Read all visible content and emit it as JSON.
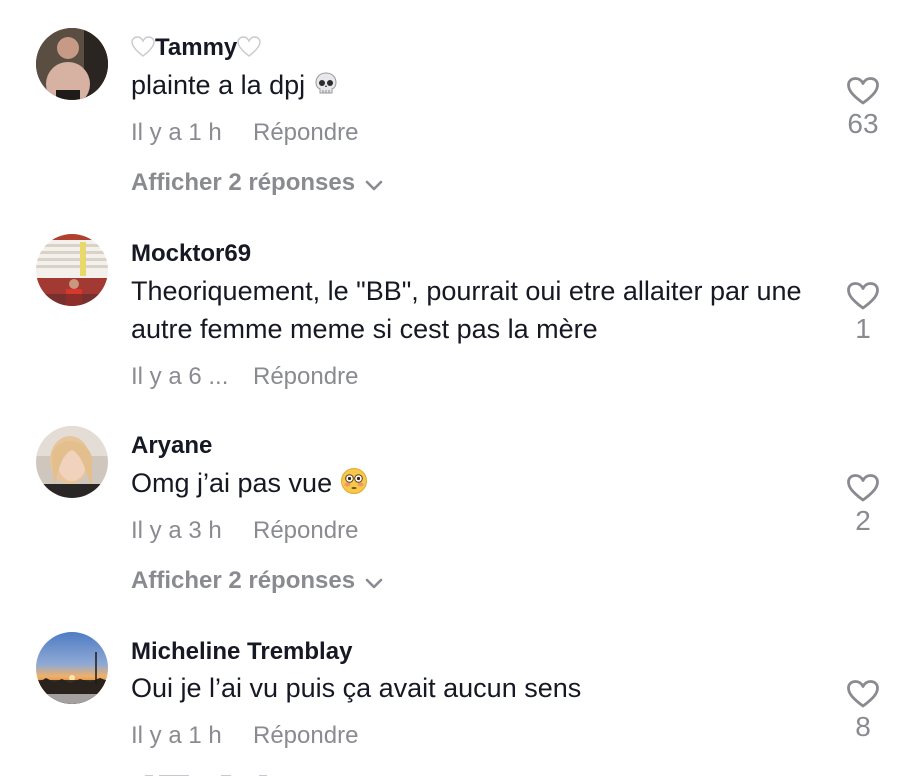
{
  "comments": [
    {
      "username": "Tammy",
      "text": "plainte a la dpj",
      "time": "Il y a 1 h",
      "reply_label": "Répondre",
      "likes": "63",
      "replies_label": "Afficher 2 réponses",
      "emoji_icon": "skull-emoji"
    },
    {
      "username": "Mocktor69",
      "text": "Theoriquement, le \"BB\", pourrait oui etre allaiter par une autre femme meme si cest pas la mère",
      "time": "Il y a 6 ...",
      "reply_label": "Répondre",
      "likes": "1"
    },
    {
      "username": "Aryane",
      "text": "Omg j’ai pas vue",
      "time": "Il y a 3 h",
      "reply_label": "Répondre",
      "likes": "2",
      "replies_label": "Afficher 2 réponses",
      "emoji_icon": "flushed-face-emoji"
    },
    {
      "username": "Micheline Tremblay",
      "text": "Oui je l’ai vu puis ça avait aucun sens",
      "time": "Il y a 1 h",
      "reply_label": "Répondre",
      "likes": "8"
    }
  ],
  "colors": {
    "text": "#161823",
    "muted": "#8a8b91",
    "background": "#ffffff"
  }
}
